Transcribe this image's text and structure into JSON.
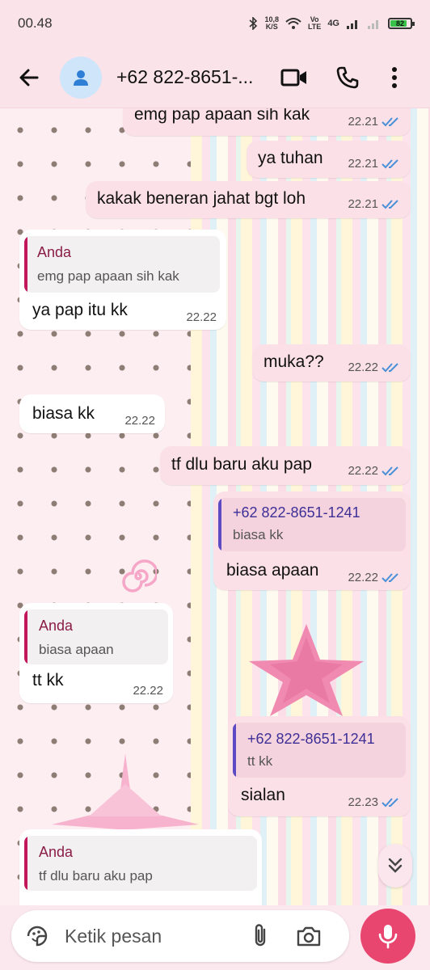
{
  "status_bar": {
    "time": "00.48",
    "net_speed_value": "10,8",
    "net_speed_unit": "K/S",
    "volte_top": "Vo",
    "volte_bottom": "LTE",
    "network": "4G",
    "battery": "82"
  },
  "header": {
    "contact_name": "+62 822-8651-...",
    "icons": [
      "back-arrow-icon",
      "person-icon",
      "video-call-icon",
      "phone-icon",
      "more-vert-icon"
    ]
  },
  "messages": [
    {
      "dir": "out",
      "text": "emg pap apaan sih kak",
      "time": "22.21",
      "read": true
    },
    {
      "dir": "out",
      "text": "ya tuhan",
      "time": "22.21",
      "read": true
    },
    {
      "dir": "out",
      "text": "kakak beneran jahat bgt loh",
      "time": "22.21",
      "read": true
    },
    {
      "dir": "in",
      "quote_name": "Anda",
      "quote_text": "emg pap apaan sih kak",
      "text": "ya pap itu kk",
      "time": "22.22"
    },
    {
      "dir": "out",
      "text": "muka??",
      "time": "22.22",
      "read": true
    },
    {
      "dir": "in",
      "text": "biasa kk",
      "time": "22.22"
    },
    {
      "dir": "out",
      "text": "tf dlu baru aku pap",
      "time": "22.22",
      "read": true
    },
    {
      "dir": "out",
      "quote_name": "+62 822-8651-1241",
      "quote_text": "biasa kk",
      "text": "biasa apaan",
      "time": "22.22",
      "read": true
    },
    {
      "dir": "in",
      "quote_name": "Anda",
      "quote_text": "biasa apaan",
      "text": "tt kk",
      "time": "22.22"
    },
    {
      "dir": "out",
      "quote_name": "+62 822-8651-1241",
      "quote_text": "tt kk",
      "text": "sialan",
      "time": "22.23",
      "read": true
    },
    {
      "dir": "in",
      "quote_name": "Anda",
      "quote_text": "tf dlu baru aku pap",
      "text": "",
      "time": ""
    }
  ],
  "input": {
    "placeholder": "Ketik pesan",
    "icons": [
      "sticker-icon",
      "attach-icon",
      "camera-icon",
      "mic-icon"
    ]
  },
  "colors": {
    "accent": "#e8466f",
    "outgoing_bubble": "#fbe0e8",
    "incoming_bubble": "#ffffff",
    "quote_you": "#c2185b",
    "quote_contact": "#5c4bc4",
    "read_ticks": "#4a90d9"
  }
}
